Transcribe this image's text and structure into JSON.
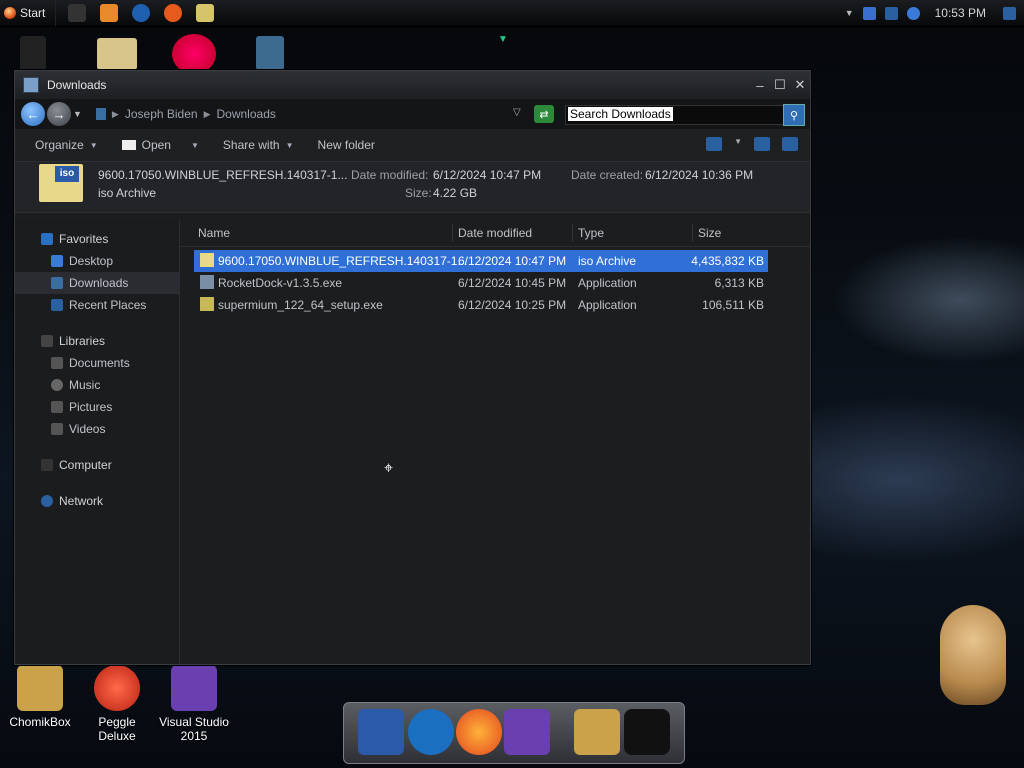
{
  "taskbar": {
    "start_label": "Start",
    "clock": "10:53 PM",
    "quick_icons": [
      "app-icon",
      "media-player-icon",
      "edge-icon",
      "firefox-icon",
      "explorer-icon"
    ],
    "tray_icons": [
      "chevron-up-icon",
      "network-icon",
      "monitor-icon",
      "speaker-icon",
      "flag-icon"
    ]
  },
  "desktop": {
    "icons": [
      {
        "name": "chomikbox-icon",
        "label": "ChomikBox",
        "color": "#c9a24a"
      },
      {
        "name": "peggle-icon",
        "label": "Peggle Deluxe",
        "color": "#d83a2a"
      },
      {
        "name": "visual-studio-icon",
        "label": "Visual Studio 2015",
        "color": "#6a3fb0"
      }
    ]
  },
  "window": {
    "title": "Downloads",
    "breadcrumb": [
      "Joseph Biden",
      "Downloads"
    ],
    "search_placeholder": "Search Downloads",
    "toolbar": {
      "organize": "Organize",
      "open": "Open",
      "share_with": "Share with",
      "new_folder": "New folder"
    },
    "details": {
      "name": "9600.17050.WINBLUE_REFRESH.140317-1...",
      "type": "iso Archive",
      "date_modified_label": "Date modified:",
      "date_modified": "6/12/2024 10:47 PM",
      "size_label": "Size:",
      "size": "4.22 GB",
      "date_created_label": "Date created:",
      "date_created": "6/12/2024 10:36 PM"
    },
    "nav": {
      "favorites": "Favorites",
      "favorite_items": [
        "Desktop",
        "Downloads",
        "Recent Places"
      ],
      "libraries": "Libraries",
      "library_items": [
        "Documents",
        "Music",
        "Pictures",
        "Videos"
      ],
      "computer": "Computer",
      "network": "Network"
    },
    "columns": {
      "name": "Name",
      "date_modified": "Date modified",
      "type": "Type",
      "size": "Size"
    },
    "files": [
      {
        "name": "9600.17050.WINBLUE_REFRESH.140317-1...",
        "date": "6/12/2024 10:47 PM",
        "type": "iso Archive",
        "size": "4,435,832 KB"
      },
      {
        "name": "RocketDock-v1.3.5.exe",
        "date": "6/12/2024 10:45 PM",
        "type": "Application",
        "size": "6,313 KB"
      },
      {
        "name": "supermium_122_64_setup.exe",
        "date": "6/12/2024 10:25 PM",
        "type": "Application",
        "size": "106,511 KB"
      }
    ]
  },
  "colors": {
    "selection": "#2f6fd6",
    "window_bg": "#1c1d1f"
  }
}
